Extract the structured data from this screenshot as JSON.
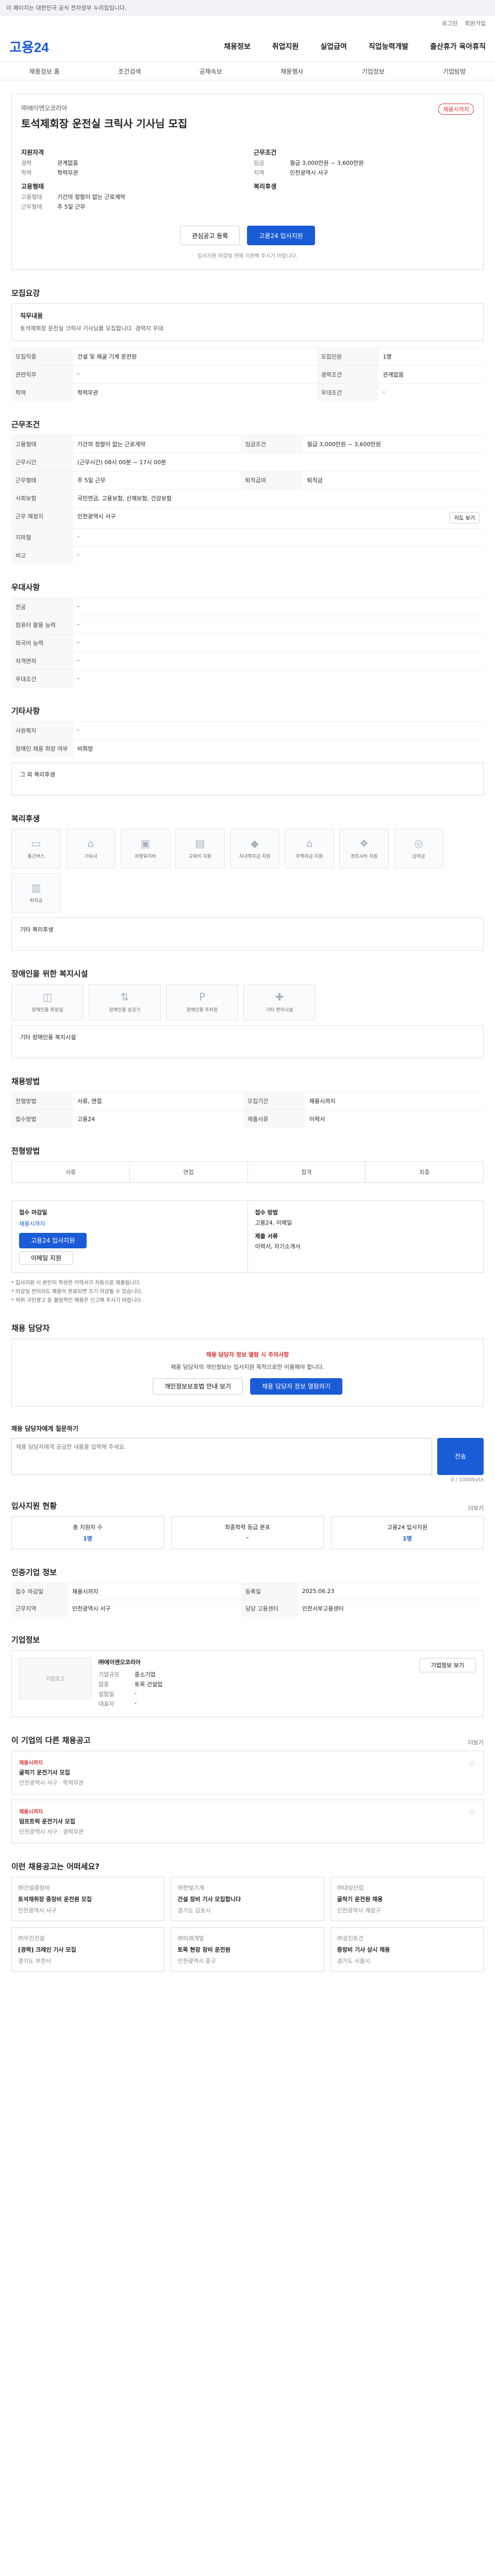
{
  "topbar": {
    "notice": "이 페이지는 대한민국 공식 전자정부 누리집입니다."
  },
  "util": {
    "login": "로그인",
    "join": "회원가입"
  },
  "header": {
    "logo": "고용24",
    "gnb": [
      "채용정보",
      "취업지원",
      "실업급여",
      "직업능력개발",
      "출산휴가 육아휴직"
    ]
  },
  "subnav": [
    "채용정보 홈",
    "조건검색",
    "공채속보",
    "채용행사",
    "기업정보",
    "기업탐방"
  ],
  "job": {
    "company": "㈜에이앤오코리아",
    "title": "토석제회장 운전실 크릭사 기사님 모집",
    "badge": "채용시까지",
    "left_head": "지원자격",
    "left_rows": [
      {
        "k": "경력",
        "v": "관계없음"
      },
      {
        "k": "학력",
        "v": "학력무관"
      }
    ],
    "left_head2": "고용형태",
    "left_rows2": [
      {
        "k": "고용형태",
        "v": "기간의 정함이 없는 근로계약"
      },
      {
        "k": "근무형태",
        "v": "주 5일 근무"
      }
    ],
    "right_head": "근무조건",
    "right_rows": [
      {
        "k": "임금",
        "v": "월급 3,000만원 ~ 3,600만원"
      },
      {
        "k": "지역",
        "v": "인천광역시 서구"
      }
    ],
    "right_head2": "복리후생",
    "apply_btn": "관심공고 등록",
    "apply_btn2": "고용24 입사지원",
    "note": "입사지원 마감일 전에 지원해 주시기 바랍니다."
  },
  "s_recruit": {
    "title": "모집요강",
    "box_title": "직무내용",
    "box_text": "토석제회장 운전실 크릭사 기사님을 모집합니다. 경력자 우대.",
    "rows": [
      {
        "k": "모집직종",
        "v": "건설 및 채굴 기계 운전원"
      },
      {
        "k": "모집인원",
        "v": "1명"
      },
      {
        "k": "관련직무",
        "v": "-"
      },
      {
        "k": "경력조건",
        "v": "관계없음"
      },
      {
        "k": "학력",
        "v": "학력무관"
      },
      {
        "k": "우대조건",
        "v": "-"
      }
    ]
  },
  "s_work": {
    "title": "근무조건",
    "rows": [
      {
        "k": "고용형태",
        "v": "기간의 정함이 없는 근로계약"
      },
      {
        "k": "임금조건",
        "v": "월급 3,000만원 ~ 3,600만원"
      },
      {
        "k": "근무시간",
        "v": "(근무시간) 08시 00분 ~ 17시 00분"
      },
      {
        "k": "근무형태",
        "v": "주 5일 근무"
      },
      {
        "k": "사회보험",
        "v": "국민연금, 고용보험, 산재보험, 건강보험"
      },
      {
        "k": "퇴직급여",
        "v": "퇴직금"
      },
      {
        "k": "근무 예정지",
        "v": "인천광역시 서구"
      },
      {
        "k": "지하철",
        "v": "-"
      },
      {
        "k": "비고",
        "v": "-"
      }
    ],
    "map_btn": "지도 보기"
  },
  "s_treat": {
    "title": "우대사항",
    "rows": [
      {
        "k": "전공",
        "v": "-"
      },
      {
        "k": "컴퓨터 활용 능력",
        "v": "-"
      },
      {
        "k": "외국어 능력",
        "v": "-"
      },
      {
        "k": "자격면허",
        "v": "-"
      },
      {
        "k": "우대조건",
        "v": "-"
      }
    ]
  },
  "s_etc": {
    "title": "기타사항",
    "rows": [
      {
        "k": "사원복지",
        "v": "-"
      },
      {
        "k": "장애인 채용 희망 여부",
        "v": "비희망"
      }
    ],
    "sub": "그 외 복리후생"
  },
  "s_welfare": {
    "title": "복리후생",
    "cards": [
      "통근버스",
      "기숙사",
      "차량유지비",
      "교육비 지원",
      "자녀학자금 지원",
      "주택자금 지원",
      "경조사비 지원",
      "상여금",
      "퇴직금"
    ],
    "note": "기타 복리후생"
  },
  "s_disab": {
    "title": "장애인을 위한 복지시설",
    "cards": [
      "장애인용 화장실",
      "장애인용 승강기",
      "장애인용 주차장",
      "기타 편의시설"
    ],
    "note": "기타 장애인용 복지시설"
  },
  "s_emp": {
    "title": "채용방법",
    "rows": [
      {
        "k": "전형방법",
        "v": "서류, 면접"
      },
      {
        "k": "모집기간",
        "v": "채용시까지"
      },
      {
        "k": "접수방법",
        "v": "고용24"
      },
      {
        "k": "제출서류",
        "v": "이력서"
      }
    ]
  },
  "s_step": {
    "title": "전형방법",
    "steps": [
      "서류",
      "면접",
      "합격",
      "최종"
    ]
  },
  "s_apply": {
    "title": "",
    "col1_h": "접수 마감일",
    "col1_v": "채용시까지",
    "col1_btn": "고용24 입사지원",
    "col1_btn2": "이메일 지원",
    "col2_h": "접수 방법",
    "col2_v": "고용24, 이메일",
    "col2_h2": "제출 서류",
    "col2_v2": "이력서, 자기소개서",
    "notes": [
      "* 입사지원 시 본인이 작성한 이력서가 자동으로 제출됩니다.",
      "* 마감일 전이라도 채용이 완료되면 조기 마감될 수 있습니다.",
      "* 허위 구인광고 등 불법적인 채용은 신고해 주시기 바랍니다."
    ]
  },
  "s_manager": {
    "title": "채용 담당자",
    "cta_title": "채용 담당자 정보 열람 시 주의사항",
    "cta_text": "채용 담당자의 개인정보는 입사지원 목적으로만 이용해야 합니다.",
    "btn1": "개인정보보호법 안내 보기",
    "btn2": "채용 담당자 정보 열람하기"
  },
  "s_qa": {
    "title": "채용 담당자에게 질문하기",
    "placeholder": "채용 담당자에게 궁금한 내용을 입력해 주세요.",
    "send": "전송",
    "count": "0 / 1000byte"
  },
  "s_stat": {
    "title": "입사지원 현황",
    "more": "더보기",
    "cells": [
      {
        "h": "총 지원자 수",
        "v": "1명"
      },
      {
        "h": "최종학력 등급 분포",
        "v": "-"
      },
      {
        "h": "고용24 입사지원",
        "v": "1명"
      }
    ]
  },
  "s_info": {
    "title": "인증기업 정보",
    "rows": [
      {
        "k": "접수 마감일",
        "v": "채용시까지"
      },
      {
        "k": "등록일",
        "v": "2025.06.23"
      },
      {
        "k": "근무지역",
        "v": "인천광역시 서구"
      },
      {
        "k": "담당 고용센터",
        "v": "인천서부고용센터"
      }
    ]
  },
  "s_company": {
    "title": "기업정보",
    "logo_ph": "기업로고",
    "name": "㈜에이앤오코리아",
    "rows": [
      {
        "k": "기업규모",
        "v": "중소기업"
      },
      {
        "k": "업종",
        "v": "토목 건설업"
      },
      {
        "k": "설립일",
        "v": "-"
      },
      {
        "k": "대표자",
        "v": "-"
      }
    ],
    "btn": "기업정보 보기"
  },
  "s_other": {
    "title": "이 기업의 다른 채용공고",
    "more": "더보기",
    "items": [
      {
        "tag": "채용시까지",
        "title": "굴착기 운전기사 모집",
        "meta": "인천광역시 서구 · 학력무관"
      },
      {
        "tag": "채용시까지",
        "title": "덤프트럭 운전기사 모집",
        "meta": "인천광역시 서구 · 경력무관"
      }
    ]
  },
  "s_reco": {
    "title": "이런 채용공고는 어떠세요?",
    "cards": [
      {
        "co": "㈜건설중장비",
        "title": "토석채취장 중장비 운전원 모집",
        "meta": "인천광역시 서구"
      },
      {
        "co": "㈜한빛기계",
        "title": "건설 장비 기사 모집합니다",
        "meta": "경기도 김포시"
      },
      {
        "co": "㈜대성산업",
        "title": "굴착기 운전원 채용",
        "meta": "인천광역시 계양구"
      },
      {
        "co": "㈜우진건설",
        "title": "[경력] 크레인 기사 모집",
        "meta": "경기도 부천시"
      },
      {
        "co": "㈜미래개발",
        "title": "토목 현장 장비 운전원",
        "meta": "인천광역시 중구"
      },
      {
        "co": "㈜성진토건",
        "title": "중장비 기사 상시 채용",
        "meta": "경기도 시흥시"
      }
    ]
  }
}
